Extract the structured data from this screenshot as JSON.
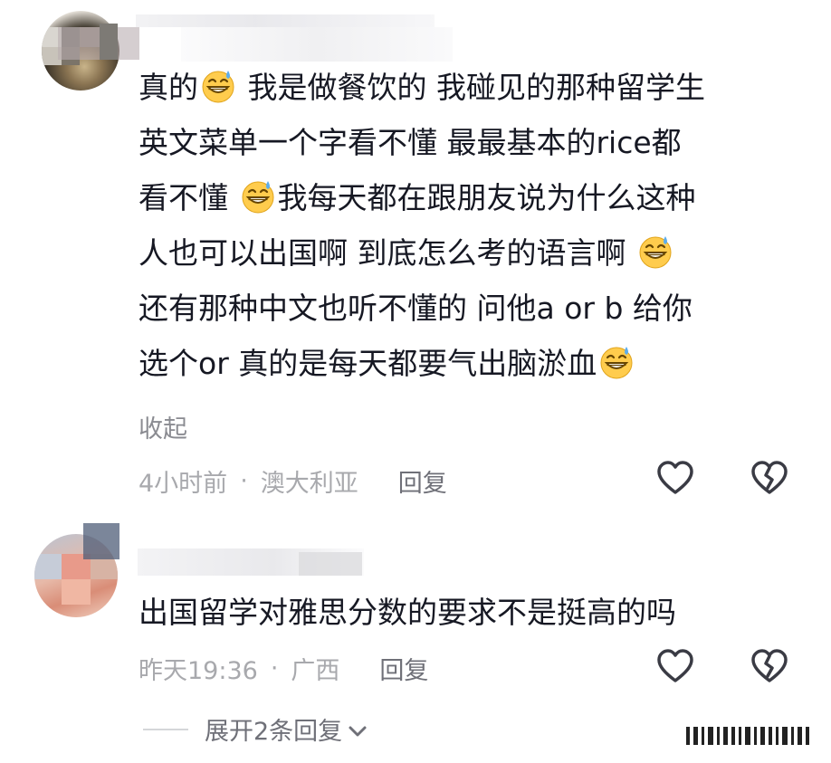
{
  "comments": [
    {
      "lines": [
        [
          "真的",
          "emoji",
          " 我是做餐饮的 我碰见的那种留学生"
        ],
        [
          "英文菜单一个字看不懂 最最基本的rice都"
        ],
        [
          "看不懂 ",
          "emoji",
          "我每天都在跟朋友说为什么这种"
        ],
        [
          "人也可以出国啊 到底怎么考的语言啊 ",
          "emoji"
        ],
        [
          "还有那种中文也听不懂的 问他a or b 给你"
        ],
        [
          "选个or 真的是每天都要气出脑淤血",
          "emoji"
        ]
      ],
      "collapse_label": "收起",
      "time": "4小时前",
      "dot": "·",
      "location": "澳大利亚",
      "reply_label": "回复"
    },
    {
      "text": "出国留学对雅思分数的要求不是挺高的吗",
      "time": "昨天19:36",
      "dot": "·",
      "location": "广西",
      "reply_label": "回复"
    }
  ],
  "expand_label": "展开2条回复",
  "icons": {
    "like": "heart-outline-icon",
    "dislike": "broken-heart-icon",
    "emoji": "grinning-sweat-emoji",
    "expand": "chevron-down-icon"
  },
  "colors": {
    "text": "#161823",
    "meta": "#a8a9ad",
    "reply": "#6f7078",
    "icon": "#3a3b44"
  }
}
